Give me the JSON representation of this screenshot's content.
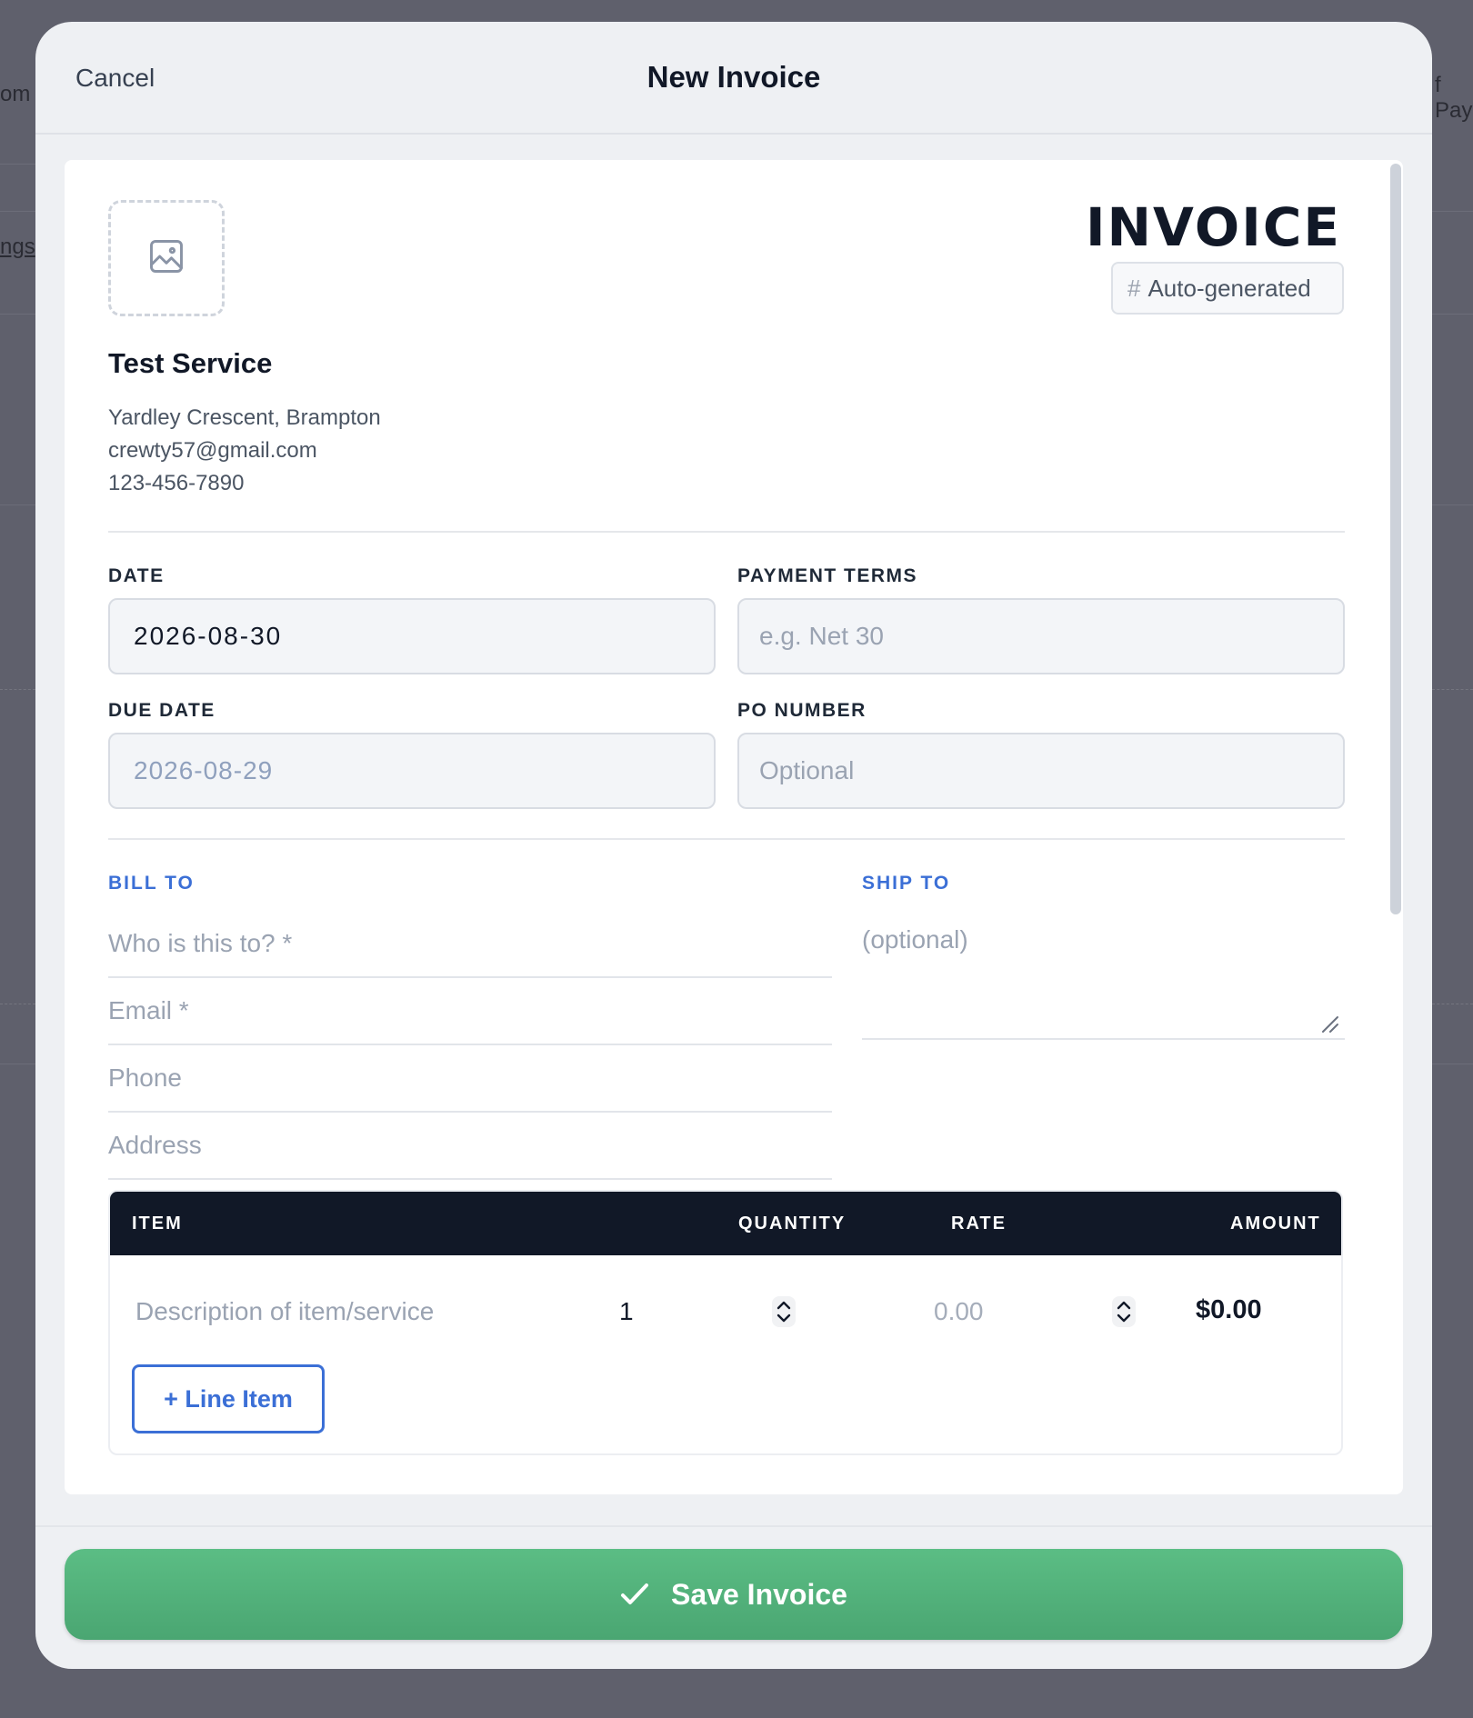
{
  "background": {
    "fragment_left_1": "om i",
    "fragment_left_2": "ngs",
    "fragment_right_1": "f Pay"
  },
  "header": {
    "cancel_label": "Cancel",
    "title": "New Invoice"
  },
  "invoice": {
    "heading": "INVOICE",
    "number_prefix": "#",
    "number_value": "Auto-generated",
    "logo_icon": "image-icon"
  },
  "business": {
    "name": "Test Service",
    "address": "Yardley Crescent, Brampton",
    "email": "crewty57@gmail.com",
    "phone": "123-456-7890"
  },
  "fields": {
    "date_label": "DATE",
    "date_value": "2026-08-30",
    "payment_terms_label": "PAYMENT TERMS",
    "payment_terms_placeholder": "e.g. Net 30",
    "due_date_label": "DUE DATE",
    "due_date_value": "2026-08-29",
    "po_number_label": "PO NUMBER",
    "po_number_placeholder": "Optional"
  },
  "bill_to": {
    "label": "BILL TO",
    "name_placeholder": "Who is this to? *",
    "email_placeholder": "Email *",
    "phone_placeholder": "Phone",
    "address_placeholder": "Address"
  },
  "ship_to": {
    "label": "SHIP TO",
    "placeholder": "(optional)"
  },
  "items": {
    "columns": [
      "ITEM",
      "QUANTITY",
      "RATE",
      "AMOUNT"
    ],
    "rows": [
      {
        "description_placeholder": "Description of item/service",
        "quantity": "1",
        "rate_placeholder": "0.00",
        "amount": "$0.00"
      }
    ],
    "add_line_label": "+ Line Item"
  },
  "footer": {
    "save_label": "Save Invoice",
    "save_icon": "check-icon"
  },
  "colors": {
    "accent_blue": "#3b6fd6",
    "save_green": "#52b47b",
    "table_header": "#111827"
  }
}
